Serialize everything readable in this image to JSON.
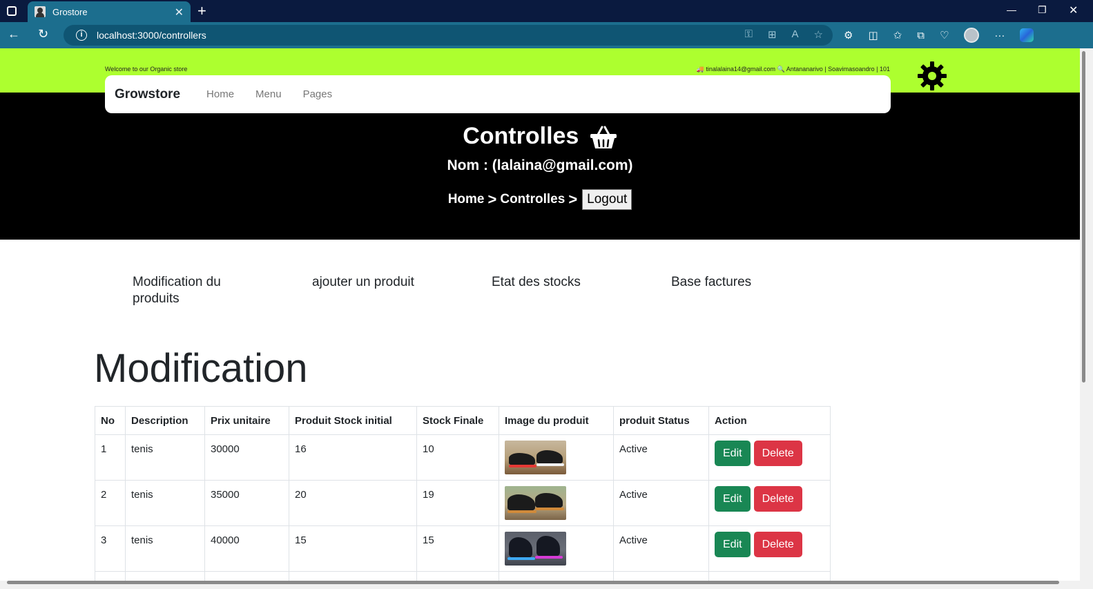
{
  "browser": {
    "tab_title": "Grostore",
    "url": "localhost:3000/controllers"
  },
  "topbar": {
    "welcome": "Welcome to our Organic store",
    "contact": "🚚 tinalalaina14@gmail.com 🔍 Antananarivo | Soavimasoandro | 101"
  },
  "navbar": {
    "brand": "Growstore",
    "links": [
      "Home",
      "Menu",
      "Pages"
    ]
  },
  "hero": {
    "title": "Controlles",
    "subtitle": "Nom : (lalaina@gmail.com)",
    "breadcrumb": [
      "Home",
      ">",
      "Controlles",
      ">"
    ],
    "logout_label": "Logout"
  },
  "menu": [
    "Modification du produits",
    "ajouter un produit",
    "Etat des stocks",
    "Base factures"
  ],
  "section_title": "Modification",
  "table": {
    "headers": [
      "No",
      "Description",
      "Prix unitaire",
      "Produit Stock initial",
      "Stock Finale",
      "Image du produit",
      "produit Status",
      "Action"
    ],
    "rows": [
      {
        "no": "1",
        "description": "tenis",
        "prix": "30000",
        "stock_initial": "16",
        "stock_finale": "10",
        "status": "Active"
      },
      {
        "no": "2",
        "description": "tenis",
        "prix": "35000",
        "stock_initial": "20",
        "stock_finale": "19",
        "status": "Active"
      },
      {
        "no": "3",
        "description": "tenis",
        "prix": "40000",
        "stock_initial": "15",
        "stock_finale": "15",
        "status": "Active"
      }
    ],
    "edit_label": "Edit",
    "delete_label": "Delete"
  },
  "colors": {
    "topbar": "#adff2f",
    "hero": "#000000",
    "edit": "#198754",
    "delete": "#dc3545",
    "browser_toolbar": "#1c6e8e",
    "browser_titlebar": "#0a1a3f"
  }
}
